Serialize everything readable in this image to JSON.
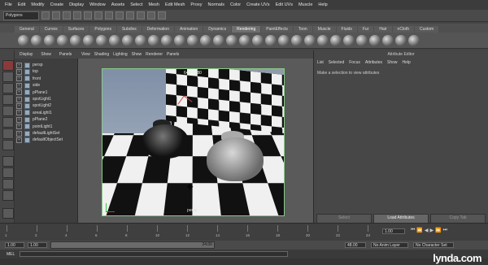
{
  "menubar": [
    "File",
    "Edit",
    "Modify",
    "Create",
    "Display",
    "Window",
    "Assets",
    "Select",
    "Mesh",
    "Edit Mesh",
    "Proxy",
    "Normals",
    "Color",
    "Create UVs",
    "Edit UVs",
    "Muscle",
    "Help"
  ],
  "status_line": {
    "mode": "Polygons"
  },
  "shelf": {
    "tabs": [
      "General",
      "Curves",
      "Surfaces",
      "Polygons",
      "Subdivs",
      "Deformation",
      "Animation",
      "Dynamics",
      "Rendering",
      "PaintEffects",
      "Toon",
      "Muscle",
      "Fluids",
      "Fur",
      "Hair",
      "nCloth",
      "Custom"
    ],
    "active_tab": "Rendering"
  },
  "outliner": {
    "menu": [
      "Display",
      "Show",
      "Panels"
    ],
    "items": [
      "persp",
      "top",
      "front",
      "side",
      "pPlane1",
      "spotLight1",
      "spotLight2",
      "areaLight1",
      "pPlane2",
      "pointLight1",
      "defaultLightSet",
      "defaultObjectSet"
    ]
  },
  "viewport": {
    "menu": [
      "View",
      "Shading",
      "Lighting",
      "Show",
      "Renderer",
      "Panels"
    ],
    "resolution_label": "640 x 480",
    "camera_label": "persp"
  },
  "attribute_editor": {
    "title": "Attribute Editor",
    "menu": [
      "List",
      "Selected",
      "Focus",
      "Attributes",
      "Show",
      "Help"
    ],
    "message": "Make a selection to view attributes",
    "buttons": {
      "select": "Select",
      "load": "Load Attributes",
      "copy": "Copy Tab"
    }
  },
  "time_slider": {
    "ticks": [
      "1",
      "2",
      "4",
      "6",
      "8",
      "10",
      "12",
      "14",
      "16",
      "18",
      "20",
      "22",
      "24"
    ],
    "current_frame": "1.00"
  },
  "range_slider": {
    "start": "1.00",
    "inner_start": "1.00",
    "inner_end": "24.00",
    "end": "48.00",
    "anim_layer": "No Anim Layer",
    "character_set": "No Character Set"
  },
  "command_line": {
    "label": "MEL"
  },
  "watermark": "lynda.com"
}
